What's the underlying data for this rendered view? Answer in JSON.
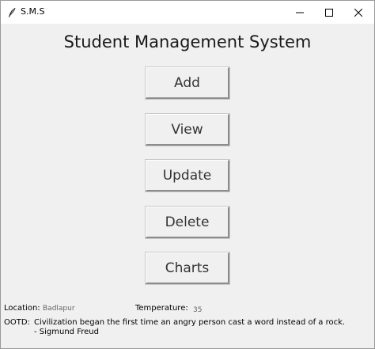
{
  "window": {
    "title": "S.M.S",
    "controls": [
      "minimize-icon",
      "maximize-icon",
      "close-icon"
    ]
  },
  "main": {
    "heading": "Student Management System",
    "buttons": [
      {
        "label": "Add"
      },
      {
        "label": "View"
      },
      {
        "label": "Update"
      },
      {
        "label": "Delete"
      },
      {
        "label": "Charts"
      }
    ]
  },
  "footer": {
    "location_label": "Location:",
    "location_value": "Badlapur",
    "temperature_label": "Temperature:",
    "temperature_value": "35",
    "ootd_label": "OOTD:",
    "ootd_quote": "Civilization began the first time an angry person cast a word instead of a rock.",
    "ootd_author": "- Sigmund Freud"
  }
}
